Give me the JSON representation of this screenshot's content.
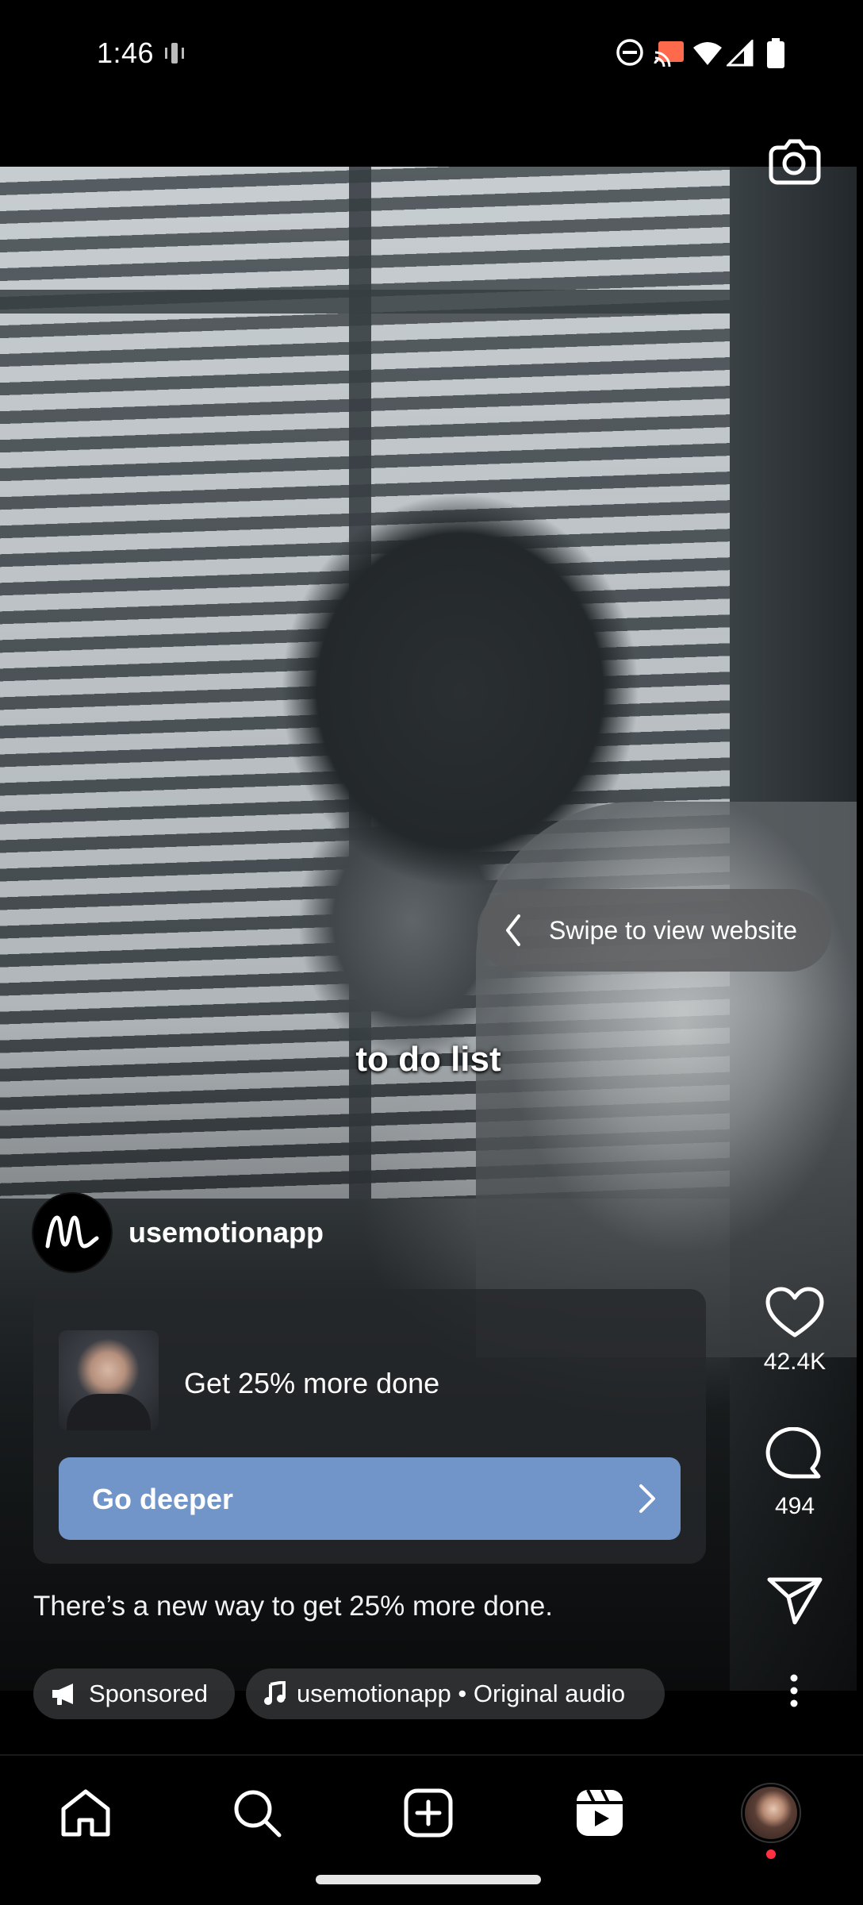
{
  "status_bar": {
    "time": "1:46",
    "icons": [
      "vibrate-icon",
      "do-not-disturb-icon",
      "cast-icon",
      "wifi-icon",
      "signal-icon",
      "battery-icon"
    ]
  },
  "reel": {
    "caption_overlay": "to do list",
    "swipe_hint": "Swipe to view website",
    "username": "usemotionapp",
    "avatar_letter": "m",
    "ad_card": {
      "title": "Get 25% more done",
      "cta_label": "Go deeper",
      "cta_color": "#7195c8"
    },
    "description": "There’s a new way to get 25% more done.",
    "chips": {
      "sponsored": "Sponsored",
      "audio": "usemotionapp • Original audio"
    }
  },
  "actions": {
    "likes": "42.4K",
    "comments": "494"
  },
  "bottom_nav": {
    "items": [
      "home-icon",
      "search-icon",
      "create-icon",
      "reels-icon",
      "profile-avatar"
    ],
    "notification_color": "#ff3040"
  }
}
